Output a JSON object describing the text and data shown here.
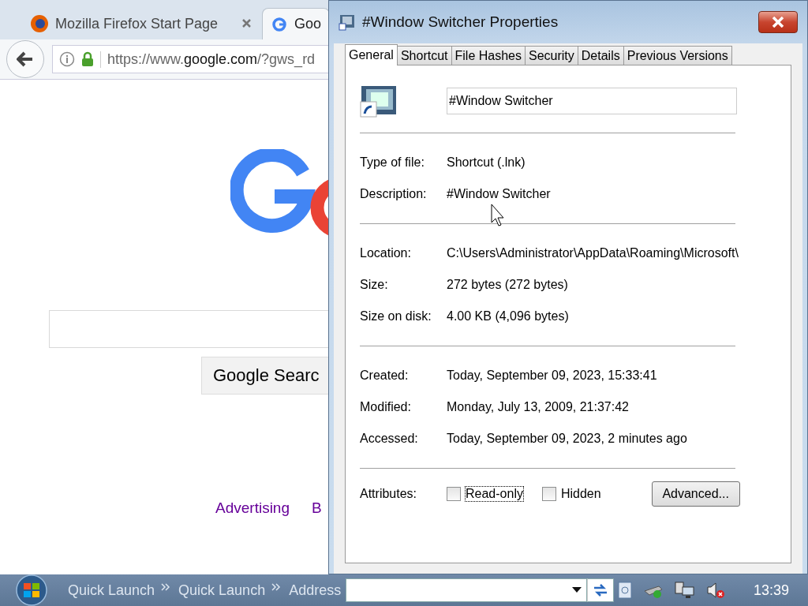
{
  "browser": {
    "tabs": [
      {
        "label": "Mozilla Firefox Start Page",
        "selected": false,
        "closable": true
      },
      {
        "label": "Goo",
        "selected": true,
        "closable": false
      }
    ],
    "address": {
      "host": "https://www.",
      "domain": "google.com",
      "path": "/?gws_rd"
    },
    "search_button": "Google Searc",
    "footer_links": [
      "Advertising",
      "B"
    ]
  },
  "dialog": {
    "title": "#Window Switcher Properties",
    "tabs": [
      {
        "label": "General",
        "selected": true
      },
      {
        "label": "Shortcut",
        "selected": false
      },
      {
        "label": "File Hashes",
        "selected": false
      },
      {
        "label": "Security",
        "selected": false
      },
      {
        "label": "Details",
        "selected": false
      },
      {
        "label": "Previous Versions",
        "selected": false
      }
    ],
    "name_value": "#Window Switcher",
    "groups": [
      [
        {
          "label": "Type of file:",
          "value": "Shortcut (.lnk)"
        },
        {
          "label": "Description:",
          "value": "#Window Switcher"
        }
      ],
      [
        {
          "label": "Location:",
          "value": "C:\\Users\\Administrator\\AppData\\Roaming\\Microsoft\\"
        },
        {
          "label": "Size:",
          "value": "272 bytes (272 bytes)"
        },
        {
          "label": "Size on disk:",
          "value": "4.00 KB (4,096 bytes)"
        }
      ],
      [
        {
          "label": "Created:",
          "value": "Today, September 09, 2023, 15:33:41"
        },
        {
          "label": "Modified:",
          "value": "Monday, July 13, 2009, 21:37:42"
        },
        {
          "label": "Accessed:",
          "value": "Today, September 09, 2023, 2 minutes ago"
        }
      ]
    ],
    "attributes_label": "Attributes:",
    "attributes": [
      {
        "label": "Read-only",
        "checked": false,
        "focused": true
      },
      {
        "label": "Hidden",
        "checked": false,
        "focused": false
      }
    ],
    "advanced_button": "Advanced..."
  },
  "taskbar": {
    "toolbars": [
      "Quick Launch",
      "Quick Launch"
    ],
    "address_label": "Address",
    "clock": "13:39"
  }
}
